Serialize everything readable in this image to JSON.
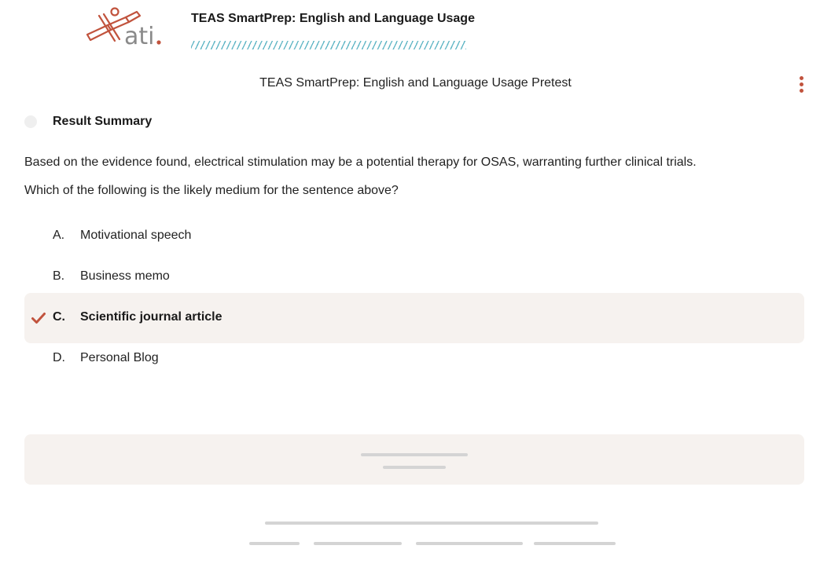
{
  "header": {
    "logo_text": "ati",
    "course_title": "TEAS SmartPrep: English and Language Usage"
  },
  "assessment_title": "TEAS SmartPrep: English and Language Usage Pretest",
  "result_summary": {
    "label": "Result Summary"
  },
  "question": {
    "stem": "Based on the evidence found, electrical stimulation may be a potential therapy for OSAS, warranting further clinical trials.",
    "prompt": "Which of the following is the likely medium for the sentence above?",
    "options": [
      {
        "letter": "A.",
        "text": "Motivational speech",
        "selected": false
      },
      {
        "letter": "B.",
        "text": "Business memo",
        "selected": false
      },
      {
        "letter": "C.",
        "text": "Scientific journal article",
        "selected": true
      },
      {
        "letter": "D.",
        "text": "Personal Blog",
        "selected": false
      }
    ]
  },
  "icons": {
    "selected_mark": "checkmark-icon",
    "menu": "more-vertical-icon",
    "logo": "ati-logo"
  },
  "colors": {
    "accent": "#c1533d",
    "title_stripes": "#63b7c6",
    "selected_background": "#f6f2ef"
  }
}
